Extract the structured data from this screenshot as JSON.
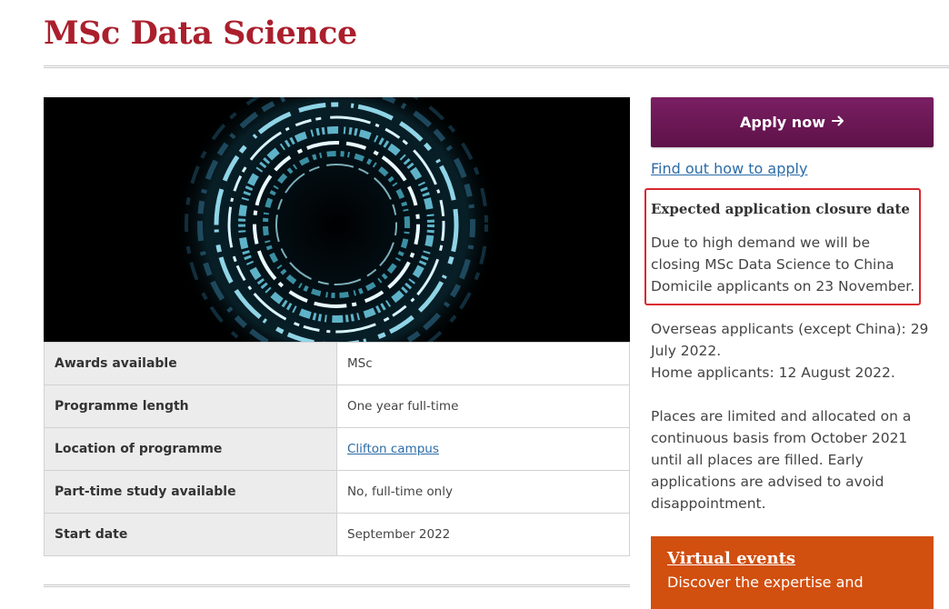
{
  "page": {
    "title": "MSc Data Science"
  },
  "hero": {
    "image": "abstract-data-rings-image"
  },
  "facts": [
    {
      "key": "Awards available",
      "value": "MSc"
    },
    {
      "key": "Programme length",
      "value": "One year full-time"
    },
    {
      "key": "Location of programme",
      "value": "Clifton campus"
    },
    {
      "key": "Part-time study available",
      "value": "No, full-time only"
    },
    {
      "key": "Start date",
      "value": "September 2022"
    }
  ],
  "sidebar": {
    "apply_label": "Apply now",
    "apply_icon": "arrow-right-icon",
    "find_out_link": "Find out how to apply",
    "closure_heading": "Expected application closure date",
    "closure_text": "Due to high demand we will be closing MSc Data Science to China Domicile applicants on 23 November.",
    "overseas_text": "Overseas applicants (except China): 29 July 2022.",
    "home_text": "Home applicants: 12 August 2022.",
    "places_text": "Places are limited and allocated on a continuous basis from October 2021 until all places are filled. Early applications are advised to avoid disappointment.",
    "events_title": "Virtual events",
    "events_text": "Discover the expertise and"
  },
  "colors": {
    "title": "#ab1f2d",
    "apply_button": "#6b1856",
    "link": "#2b6ca8",
    "closure_border": "#d9272e",
    "events_background": "#d14f0f"
  }
}
